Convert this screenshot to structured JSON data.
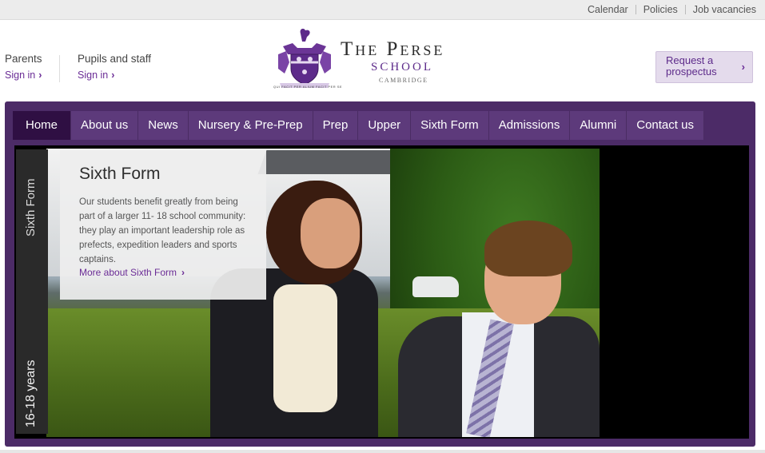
{
  "utility": {
    "calendar": "Calendar",
    "policies": "Policies",
    "jobs": "Job vacancies"
  },
  "signin": {
    "parents_label": "Parents",
    "parents_link": "Sign in",
    "pupils_label": "Pupils and staff",
    "pupils_link": "Sign in",
    "chevron": "›"
  },
  "logo": {
    "title_line": "The Perse",
    "school": "SCHOOL",
    "city": "CAMBRIDGE",
    "motto": "QUI FACIT PER ALIUM FACIT PER SE"
  },
  "prospectus": {
    "line1": "Request a",
    "line2": "prospectus",
    "chevron": "›"
  },
  "nav": [
    {
      "label": "Home",
      "active": true
    },
    {
      "label": "About us"
    },
    {
      "label": "News"
    },
    {
      "label": "Nursery & Pre-Prep"
    },
    {
      "label": "Prep"
    },
    {
      "label": "Upper"
    },
    {
      "label": "Sixth Form"
    },
    {
      "label": "Admissions"
    },
    {
      "label": "Alumni"
    },
    {
      "label": "Contact us"
    }
  ],
  "hero": {
    "tab_top": "Sixth Form",
    "tab_bottom": "16-18 years",
    "title": "Sixth Form",
    "body": "Our students benefit greatly from being part of a larger 11- 18 school community: they play an important leadership role as prefects, expedition leaders and sports captains.",
    "more": "More about Sixth Form",
    "chevron": "›"
  },
  "colors": {
    "brand_purple": "#4c2b67",
    "nav_item": "#5d3a7b",
    "nav_active": "#2f0f43",
    "link": "#6a2c96"
  }
}
